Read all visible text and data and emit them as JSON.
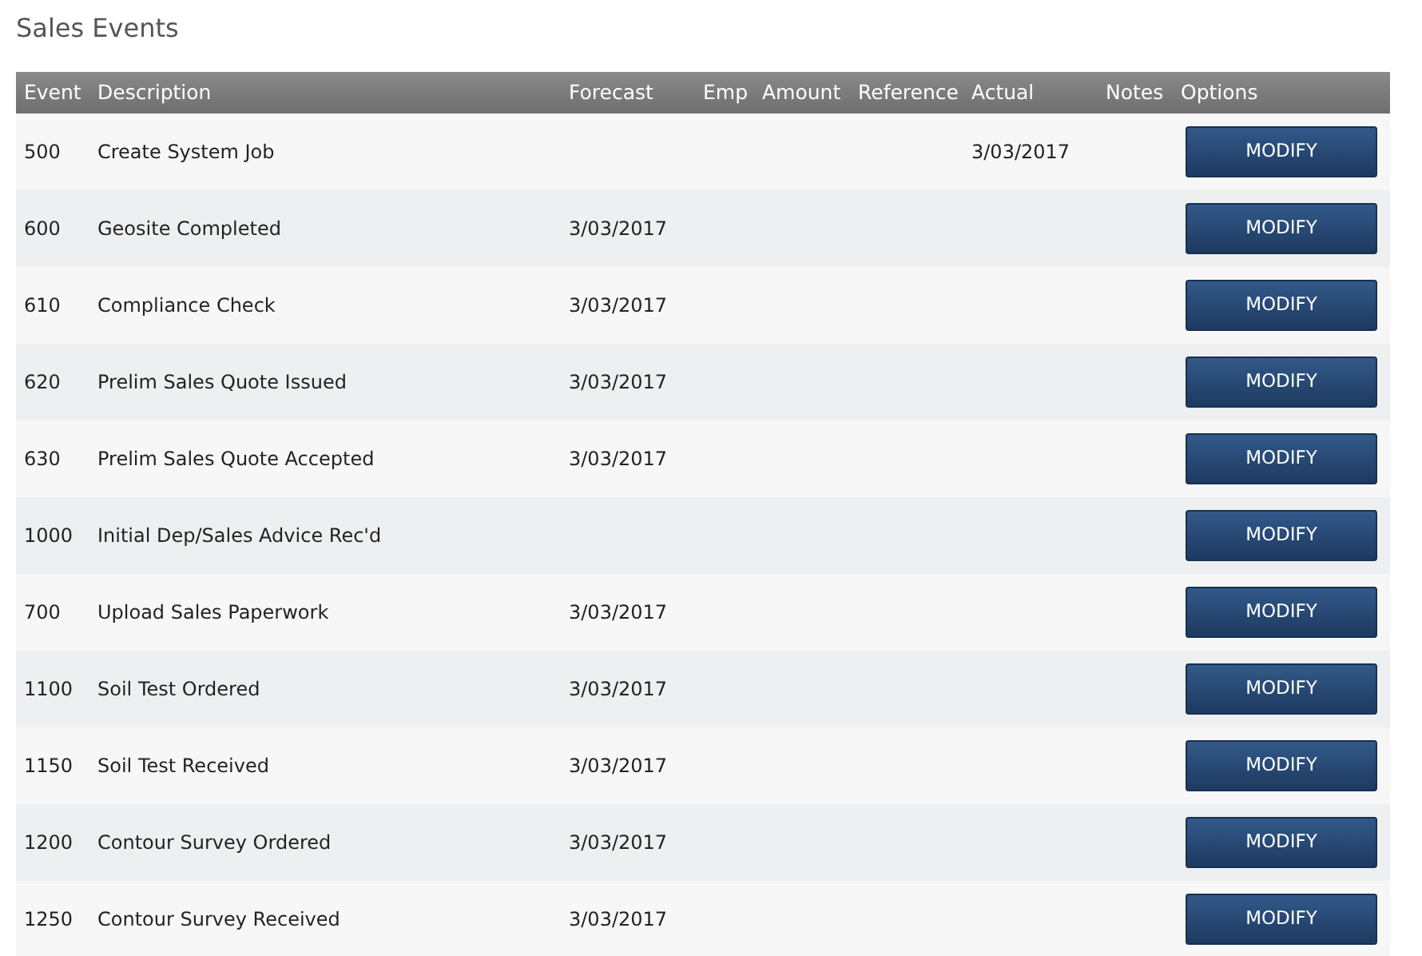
{
  "title": "Sales Events",
  "columns": [
    "Event",
    "Description",
    "Forecast",
    "Emp",
    "Amount",
    "Reference",
    "Actual",
    "Notes",
    "Options"
  ],
  "rows": [
    {
      "event": "500",
      "description": "Create System Job",
      "actual": "3/03/2017",
      "button": "MODIFY"
    },
    {
      "event": "600",
      "description": "Geosite Completed",
      "forecast": "3/03/2017",
      "button": "MODIFY"
    },
    {
      "event": "610",
      "description": "Compliance Check",
      "forecast": "3/03/2017",
      "button": "MODIFY"
    },
    {
      "event": "620",
      "description": "Prelim Sales Quote Issued",
      "forecast": "3/03/2017",
      "button": "MODIFY"
    },
    {
      "event": "630",
      "description": "Prelim Sales Quote Accepted",
      "forecast": "3/03/2017",
      "button": "MODIFY"
    },
    {
      "event": "1000",
      "description": "Initial Dep/Sales Advice Rec'd",
      "button": "MODIFY"
    },
    {
      "event": "700",
      "description": "Upload Sales Paperwork",
      "forecast": "3/03/2017",
      "button": "MODIFY"
    },
    {
      "event": "1100",
      "description": "Soil Test Ordered",
      "forecast": "3/03/2017",
      "button": "MODIFY"
    },
    {
      "event": "1150",
      "description": "Soil Test Received",
      "forecast": "3/03/2017",
      "button": "MODIFY"
    },
    {
      "event": "1200",
      "description": "Contour Survey Ordered",
      "forecast": "3/03/2017",
      "button": "MODIFY"
    },
    {
      "event": "1250",
      "description": "Contour Survey Received",
      "forecast": "3/03/2017",
      "button": "MODIFY"
    }
  ]
}
